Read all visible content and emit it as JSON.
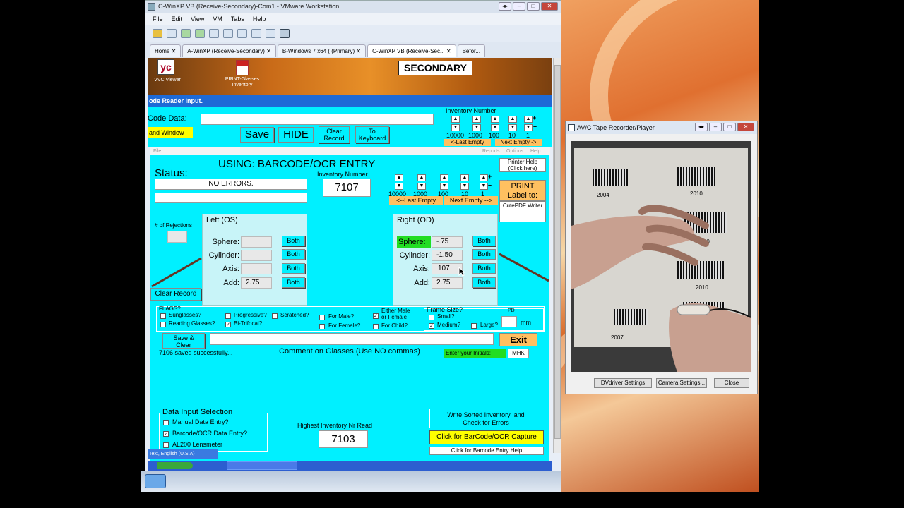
{
  "vmware": {
    "title": "C-WinXP VB (Receive-Secondary)-Com1 - VMware Workstation",
    "menus": [
      "File",
      "Edit",
      "View",
      "VM",
      "Tabs",
      "Help"
    ],
    "tabs": [
      "Home",
      "A-WinXP (Receive-Secondary)",
      "B-Windows 7 x64 ( (Primary)",
      "C-WinXP VB (Receive-Sec...",
      "Befor..."
    ]
  },
  "guest": {
    "icon_vvc": "VVC Viewer",
    "icon_print": "PRINT-Glasses\nInventory",
    "secondary": "SECONDARY",
    "bar_title": "ode Reader Input.",
    "code_data_label": "Code Data:",
    "and_window": "and Window",
    "save": "Save",
    "hide": "HIDE",
    "clear_record_top": "Clear\nRecord",
    "to_keyboard": "To\nKeyboard",
    "inv_number_label": "Inventory Number",
    "digits": [
      "10000",
      "1000",
      "100",
      "10",
      "1"
    ],
    "last_empty": "<-Last Empty",
    "next_empty": "Next Empty ->",
    "last_empty2": "<--Last Empty",
    "next_empty2": "Next Empty -->"
  },
  "form": {
    "header": "USING:  BARCODE/OCR ENTRY",
    "file_menu": "File",
    "right_menus": [
      "Reports",
      "Options",
      "Help"
    ],
    "status_label": "Status:",
    "status_value": "NO ERRORS.",
    "inv_label": "Inventory Number",
    "inv_value": "7107",
    "printer_help": "Printer Help\n(Click here)",
    "print_label": "PRINT\nLabel to:",
    "printer": "CutePDF Writer",
    "rejections_label": "# of Rejections",
    "left_title": "Left  (OS)",
    "right_title": "Right  (OD)",
    "fields": [
      "Sphere:",
      "Cylinder:",
      "Axis:",
      "Add:"
    ],
    "left_values": [
      "",
      "",
      "",
      "2.75"
    ],
    "right_values": [
      "-.75",
      "-1.50",
      "107",
      "2.75"
    ],
    "both": "Both",
    "clear_record": "Clear Record",
    "flags_label": "FLAGS?",
    "flags": {
      "sunglasses": "Sunglasses?",
      "reading": "Reading Glasses?",
      "progressive": "Progressive?",
      "bitrifocal": "Bi-Trifocal?",
      "scratched": "Scratched?",
      "male": "For Male?",
      "female": "For Female?",
      "either": "Either Male\nor Female",
      "child": "For Child?"
    },
    "frame_label": "Frame Size?",
    "frame": {
      "small": "Small?",
      "medium": "Medium?",
      "large": "Large?"
    },
    "pd_label": "PD",
    "mm": "mm",
    "save_clear": "Save &\nClear",
    "exit": "Exit",
    "saved_msg": "7106 saved successfully...",
    "comment_label": "Comment on Glasses (Use NO commas)",
    "initials_label": "Enter your Initials:",
    "initials_value": "MHK",
    "data_input_label": "Data Input Selection",
    "input_opts": [
      "Manual Data Entry?",
      "Barcode/OCR Data Entry?",
      "AL200 Lensmeter"
    ],
    "highest_label": "Highest Inventory Nr Read",
    "highest_value": "7103",
    "write_sorted": "Write Sorted Inventory  and\nCheck for Errors",
    "click_capture": "Click for BarCode/OCR Capture",
    "click_help": "Click for Barcode Entry Help",
    "lang": "Text, English (U.S.A)"
  },
  "recorder": {
    "title": "AV/C Tape Recorder/Player",
    "btn_dv": "DVdriver Settings",
    "btn_cam": "Camera Settings...",
    "btn_close": "Close",
    "labels": [
      "2004",
      "2010",
      "2010",
      "2010",
      "2010",
      "2007"
    ]
  },
  "colors": {
    "cyan": "#00f0ff",
    "green": "#22dd22",
    "yellow": "#ffff00",
    "orange": "#ffc060",
    "blue": "#1e6ad6"
  }
}
